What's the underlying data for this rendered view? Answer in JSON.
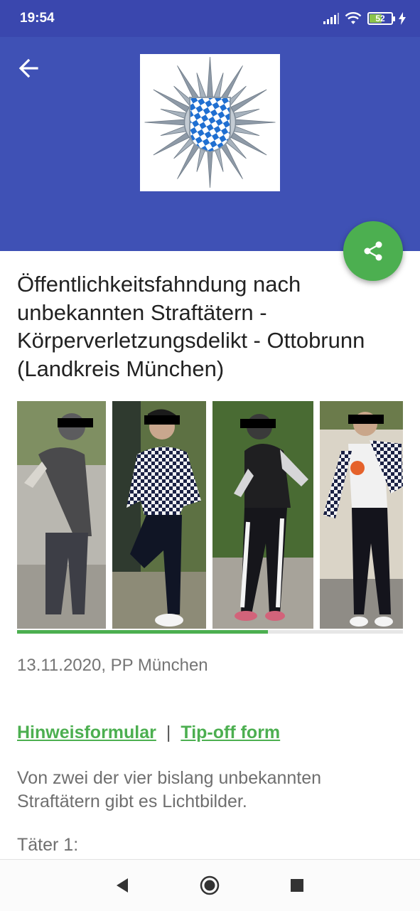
{
  "status_bar": {
    "time": "19:54",
    "battery_level": "52",
    "icons": [
      "signal-icon",
      "wifi-icon",
      "battery-icon",
      "charging-icon"
    ]
  },
  "header": {
    "back_icon": "arrow-back-icon",
    "logo": "bavarian-police-star-logo",
    "share_icon": "share-icon"
  },
  "article": {
    "title": "Öffentlichkeitsfahndung nach unbekannten Straftätern - Körperverletzungsdelikt - Ottobrunn (Landkreis München)",
    "date_source": "13.11.2020, PP München",
    "links": {
      "hint_form": "Hinweisformular",
      "separator": "|",
      "tip_off_form": "Tip-off form"
    },
    "intro": "Von zwei der vier bislang unbekannten Straftätern gibt es Lichtbilder.",
    "suspect_label": "Täter 1:"
  },
  "gallery": {
    "photo_count": 4,
    "progress_fraction": 0.65
  },
  "nav_bar": {
    "buttons": [
      "back-triangle-icon",
      "home-circle-icon",
      "recents-square-icon"
    ]
  },
  "colors": {
    "status_bar": "#3a47ae",
    "header": "#3f51b5",
    "accent_green": "#4caf50",
    "text_primary": "#222222",
    "text_secondary": "#6f6f6f"
  }
}
